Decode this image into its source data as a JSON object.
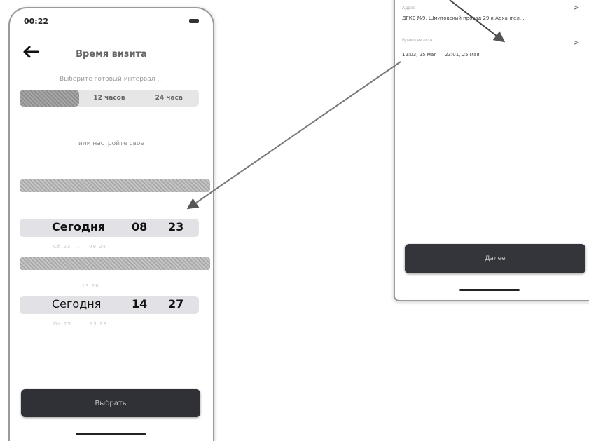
{
  "left_screen": {
    "status_time": "00:22",
    "status_signal": "...",
    "title": "Время визита",
    "hint": "Выберите готовый интервал ...",
    "segments": [
      "",
      "12 часов",
      "24 часа"
    ],
    "custom_hint": "или настройте свое",
    "start_picker": {
      "day": "Сегодня",
      "hour": "08",
      "minute": "23",
      "above_row": "... ...... .... .....",
      "below_row": "Сб 23 ......   09   24"
    },
    "end_picker": {
      "day": "Сегодня",
      "hour": "14",
      "minute": "27",
      "above_row": "... .......   13   26",
      "below_row": "Пн 25 ......   15   28"
    },
    "select_button": "Выбрать"
  },
  "right_screen": {
    "address_label": "Адрес",
    "address_value": "ДГКБ №9, Шмитовский проезд 29 к Архангел…",
    "visit_time_label": "Время визита",
    "visit_time_value": "12:03, 25 мая — 23:01, 25 мая",
    "chevron": ">",
    "done_button": "Далее"
  },
  "icons": {
    "back": "back-arrow-icon",
    "chevron": "chevron-right-icon"
  }
}
